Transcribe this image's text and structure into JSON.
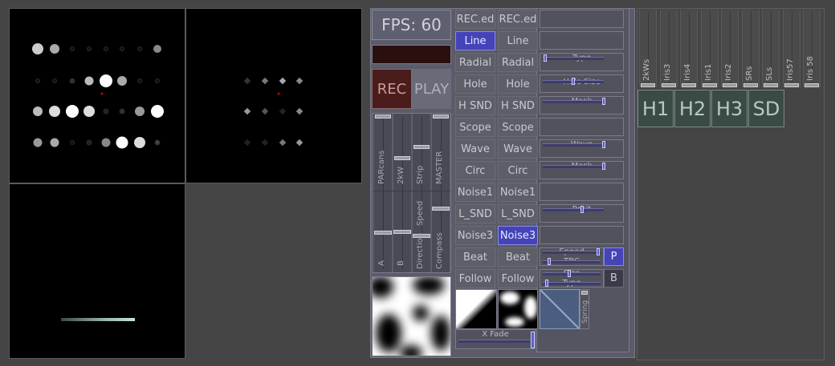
{
  "stats": {
    "fps_label": "FPS: 60"
  },
  "transport": {
    "rec": "REC",
    "play": "PLAY"
  },
  "channel_labels": {
    "parcans": "PARcans",
    "kw2": "2kW",
    "strip": "Strip",
    "master": "MASTER",
    "a": "A",
    "b": "B",
    "direction": "Direction",
    "speed": "Speed",
    "compass": "Compass"
  },
  "effects_left": [
    "REC.ed",
    "Line",
    "Radial",
    "Hole",
    "H SND",
    "Scope",
    "Wave",
    "Circ",
    "Noise1",
    "L_SND",
    "Noise3",
    "Beat",
    "Follow"
  ],
  "effects_right": [
    "REC.ed",
    "Line",
    "Radial",
    "Hole",
    "H SND",
    "Scope",
    "Wave",
    "Circ",
    "Noise1",
    "L_SND",
    "Noise3",
    "Beat",
    "Follow"
  ],
  "active": {
    "left": "Line",
    "right": "Noise3"
  },
  "params": {
    "type": "Type",
    "hole_size": "Hole Size",
    "mask1": "Mask",
    "wave": "Wave",
    "mask2": "Mask",
    "posit": "Posit",
    "speed": "Speed",
    "tbc": "TBC",
    "size": "Size",
    "type2": "Type",
    "spring": "Spring"
  },
  "param_levels": {
    "type": 0.02,
    "hole_size": 0.48,
    "mask1": 0.98,
    "wave": 0.98,
    "mask2": 0.98,
    "posit": 0.62,
    "speed": 0.95,
    "tbc": 0.1,
    "size": 0.45,
    "type2": 0.05
  },
  "toggles": {
    "p": "P",
    "b": "B"
  },
  "crossfade": {
    "label": "X Fade"
  },
  "faders": [
    "2kWs",
    "Iris3",
    "Iris4",
    "Iris1",
    "Iris2",
    "SRs",
    "SLs",
    "Iris57",
    "Iris 58"
  ],
  "groups": [
    "H1",
    "H2",
    "H3",
    "SD"
  ],
  "colors": {
    "active": "#4444b8",
    "panel": "#5e5e68",
    "rec_bg": "#4a1c1c",
    "group_bg": "#3a4a44"
  }
}
